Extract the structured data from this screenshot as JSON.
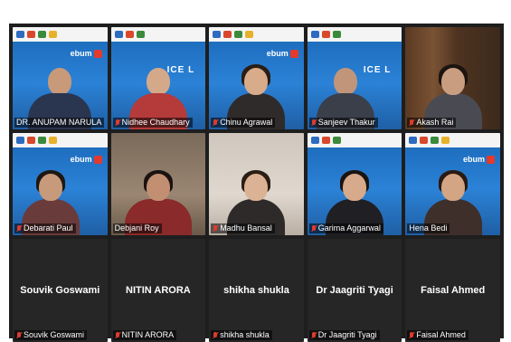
{
  "colors": {
    "background": "#1e1e1e",
    "active_speaker_border": "#f2d54a",
    "mic_off": "#e23a2e",
    "backdrop_blue": "#2b82d6"
  },
  "branding": {
    "label": "ebum",
    "conference_label": "ICE L"
  },
  "participants": [
    {
      "name": "DR. ANUPAM NARULA",
      "muted": false,
      "active_speaker": true
    },
    {
      "name": "Nidhee Chaudhary",
      "muted": true
    },
    {
      "name": "Chinu Agrawal",
      "muted": true
    },
    {
      "name": "Sanjeev Thakur",
      "muted": true
    },
    {
      "name": "Akash Rai",
      "muted": true
    },
    {
      "name": "Debarati Paul",
      "muted": true
    },
    {
      "name": "Debjani Roy",
      "muted": false
    },
    {
      "name": "Madhu Bansal",
      "muted": true
    },
    {
      "name": "Garima Aggarwal",
      "muted": true
    },
    {
      "name": "Hena Bedi",
      "muted": false
    },
    {
      "name": "Souvik Goswami",
      "muted": true
    },
    {
      "name": "NITIN ARORA",
      "muted": true
    },
    {
      "name": "shikha shukla",
      "muted": true
    },
    {
      "name": "Dr Jaagriti Tyagi",
      "muted": true
    },
    {
      "name": "Faisal Ahmed",
      "muted": true
    }
  ]
}
